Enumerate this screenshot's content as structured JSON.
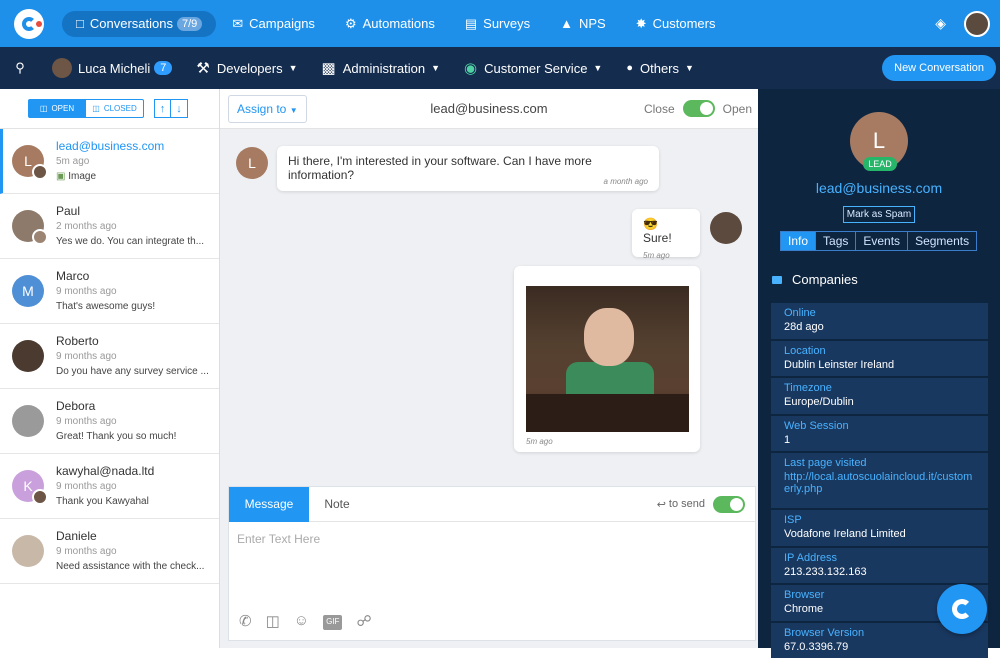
{
  "topnav": {
    "items": [
      {
        "label": "Conversations",
        "badge": "7/9",
        "icon": "chat-icon"
      },
      {
        "label": "Campaigns",
        "icon": "envelope-icon"
      },
      {
        "label": "Automations",
        "icon": "robot-icon"
      },
      {
        "label": "Surveys",
        "icon": "bar-chart-icon"
      },
      {
        "label": "NPS",
        "icon": "thumbs-up-icon"
      },
      {
        "label": "Customers",
        "icon": "network-icon"
      }
    ]
  },
  "subnav": {
    "user": "Luca Micheli",
    "user_badge": "7",
    "items": [
      {
        "label": "Developers",
        "icon": "tools-icon"
      },
      {
        "label": "Administration",
        "icon": "briefcase-icon"
      },
      {
        "label": "Customer Service",
        "icon": "octopus-icon"
      },
      {
        "label": "Others",
        "icon": "people-icon"
      }
    ],
    "new_conversation": "New Conversation"
  },
  "inbox": {
    "open_label": "OPEN",
    "closed_label": "CLOSED",
    "conversations": [
      {
        "name": "lead@business.com",
        "time": "5m ago",
        "message": "Image",
        "initial": "L",
        "color": "#a77b62"
      },
      {
        "name": "Paul",
        "time": "2 months ago",
        "message": "Yes we do.  You can integrate th...",
        "initial": "",
        "color": "#8d7a6b"
      },
      {
        "name": "Marco",
        "time": "9 months ago",
        "message": "That's awesome guys!",
        "initial": "M",
        "color": "#4f8fd6"
      },
      {
        "name": "Roberto",
        "time": "9 months ago",
        "message": "Do you have any survey service ...",
        "initial": "",
        "color": "#4a3a30"
      },
      {
        "name": "Debora",
        "time": "9 months ago",
        "message": "Great! Thank you so much!",
        "initial": "",
        "color": "#9a9a9a"
      },
      {
        "name": "kawyhal@nada.ltd",
        "time": "9 months ago",
        "message": "Thank you Kawyahal",
        "initial": "K",
        "color": "#c9a0dc"
      },
      {
        "name": "Daniele",
        "time": "9 months ago",
        "message": "Need assistance with the check...",
        "initial": "",
        "color": "#c8b8a8"
      }
    ]
  },
  "chat": {
    "assign_label": "Assign to",
    "email": "lead@business.com",
    "close_label": "Close",
    "open_label": "Open",
    "lead_initial": "L",
    "messages": [
      {
        "text": "Hi there, I'm interested in your software. Can I have more information?",
        "time": "a month ago"
      },
      {
        "text": "Sure!",
        "time": "5m ago",
        "emoji": "😎"
      },
      {
        "text": "",
        "time": "5m ago"
      }
    ],
    "composer": {
      "tab_message": "Message",
      "tab_note": "Note",
      "to_send": "to send",
      "placeholder": "Enter Text Here",
      "gif_label": "GIF"
    }
  },
  "profile": {
    "initial": "L",
    "tag": "LEAD",
    "email": "lead@business.com",
    "mark_spam": "Mark as Spam",
    "tabs": [
      "Info",
      "Tags",
      "Events",
      "Segments"
    ],
    "section": "Companies",
    "fields": [
      {
        "label": "Online",
        "value": "28d ago"
      },
      {
        "label": "Location",
        "value": "Dublin Leinster Ireland"
      },
      {
        "label": "Timezone",
        "value": "Europe/Dublin"
      },
      {
        "label": "Web Session",
        "value": "1"
      },
      {
        "label": "Last page visited",
        "value": "http://local.autoscuolaincloud.it/customerly.php"
      },
      {
        "label": "ISP",
        "value": "Vodafone Ireland Limited"
      },
      {
        "label": "IP Address",
        "value": "213.233.132.163"
      },
      {
        "label": "Browser",
        "value": "Chrome"
      },
      {
        "label": "Browser Version",
        "value": "67.0.3396.79"
      }
    ]
  },
  "colors": {
    "accent": "#2196f3",
    "topbar": "#1e90ea",
    "subbar": "#142c4e",
    "panel": "#0e2540",
    "lead_green": "#26b66a"
  }
}
